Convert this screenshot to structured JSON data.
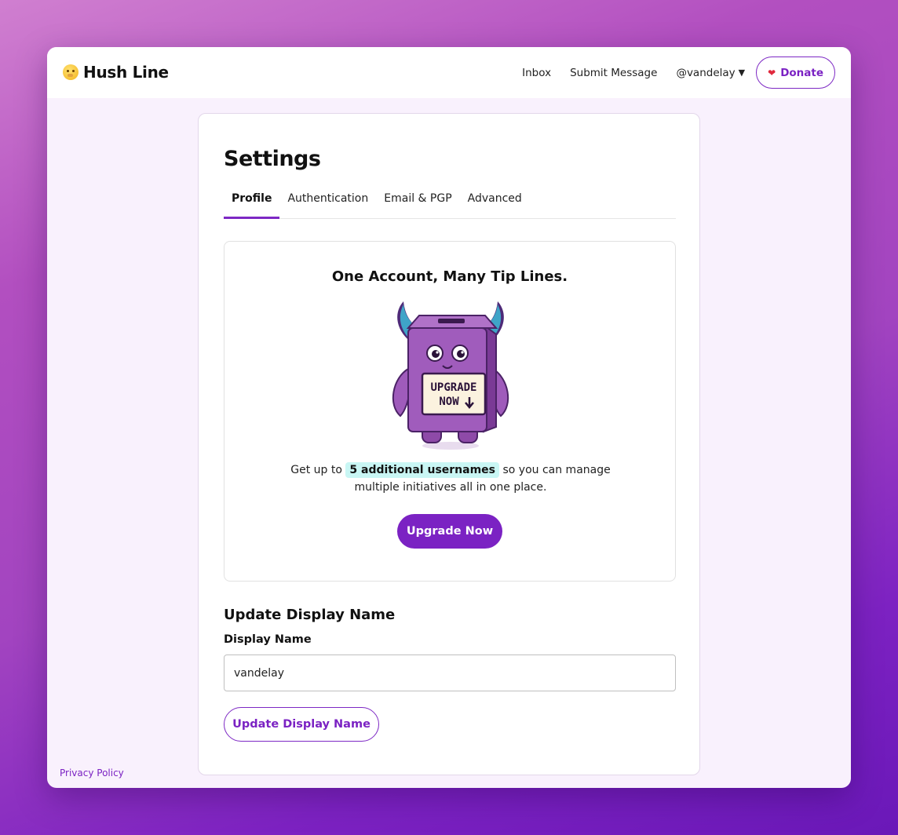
{
  "app": {
    "name": "Hush Line"
  },
  "nav": {
    "items": [
      {
        "label": "Inbox"
      },
      {
        "label": "Submit Message"
      }
    ],
    "user": "@vandelay",
    "donate_label": "Donate"
  },
  "settings": {
    "title": "Settings",
    "tabs": [
      {
        "label": "Profile",
        "active": true
      },
      {
        "label": "Authentication",
        "active": false
      },
      {
        "label": "Email & PGP",
        "active": false
      },
      {
        "label": "Advanced",
        "active": false
      }
    ]
  },
  "promo": {
    "title": "One Account, Many Tip Lines.",
    "mascot_sign": [
      "UPGRADE",
      "NOW"
    ],
    "text_before": "Get up to",
    "highlight": "5 additional usernames",
    "text_after": "so you can manage multiple initiatives all in one place.",
    "button_label": "Upgrade Now"
  },
  "display_name_section": {
    "title": "Update Display Name",
    "field_label": "Display Name",
    "value": "vandelay",
    "button_label": "Update Display Name"
  },
  "footer": {
    "privacy_label": "Privacy Policy"
  },
  "colors": {
    "accent": "#7b22c3",
    "highlight": "#c9f6f4",
    "window_bg": "#f9f1fd"
  }
}
